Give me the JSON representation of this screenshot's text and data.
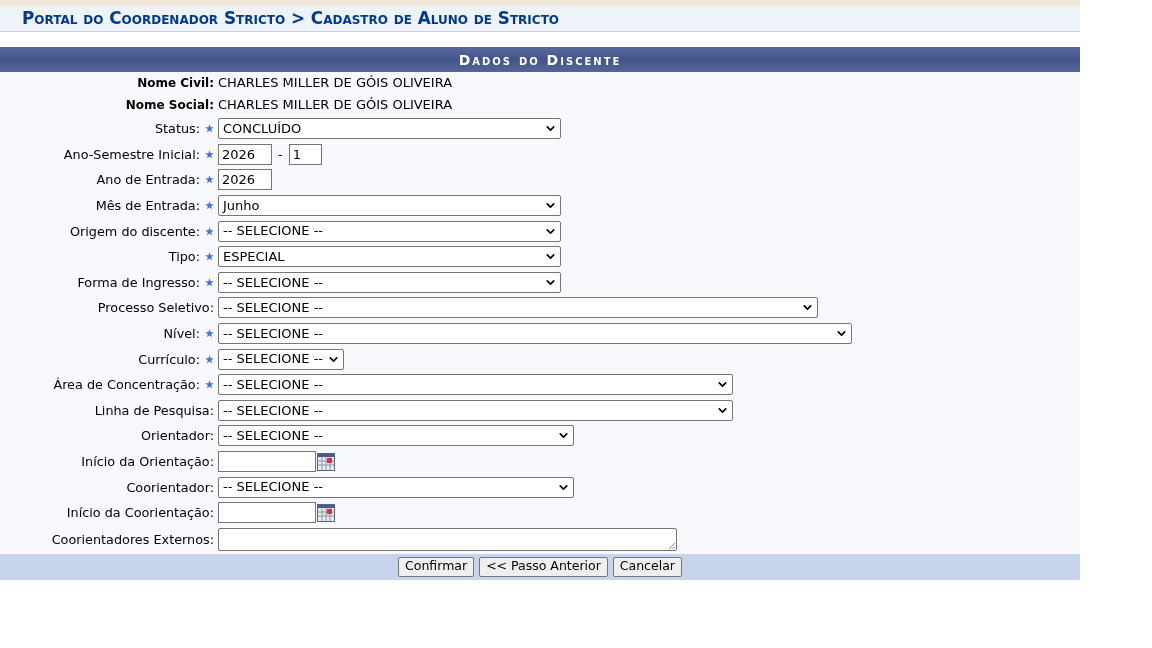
{
  "breadcrumb": "Portal do Coordenador Stricto > Cadastro de Aluno de Stricto",
  "form": {
    "title": "Dados do Discente",
    "fields": [
      {
        "label": "Nome Civil:",
        "required": false,
        "kind": "static",
        "value": "CHARLES MILLER DE GÓIS OLIVEIRA"
      },
      {
        "label": "Nome Social:",
        "required": false,
        "kind": "static",
        "value": "CHARLES MILLER DE GÓIS OLIVEIRA"
      },
      {
        "label": "Status:",
        "required": true,
        "kind": "select",
        "value": "CONCLUÍDO"
      },
      {
        "label": "Ano-Semestre Inicial:",
        "required": true,
        "kind": "year_semester",
        "year": "2026",
        "separator": "-",
        "semester": "1"
      },
      {
        "label": "Ano de Entrada:",
        "required": true,
        "kind": "text",
        "value": "2026"
      },
      {
        "label": "Mês de Entrada:",
        "required": true,
        "kind": "select",
        "value": "Junho"
      },
      {
        "label": "Origem do discente:",
        "required": true,
        "kind": "select",
        "value": "-- SELECIONE --"
      },
      {
        "label": "Tipo:",
        "required": true,
        "kind": "select",
        "value": "ESPECIAL"
      },
      {
        "label": "Forma de Ingresso:",
        "required": true,
        "kind": "select",
        "value": "-- SELECIONE --"
      },
      {
        "label": "Processo Seletivo:",
        "required": false,
        "kind": "select",
        "value": "-- SELECIONE --"
      },
      {
        "label": "Nível:",
        "required": true,
        "kind": "select",
        "value": "-- SELECIONE --"
      },
      {
        "label": "Currículo:",
        "required": true,
        "kind": "select",
        "value": "-- SELECIONE --"
      },
      {
        "label": "Área de Concentração:",
        "required": true,
        "kind": "select",
        "value": "-- SELECIONE --"
      },
      {
        "label": "Linha de Pesquisa:",
        "required": false,
        "kind": "select",
        "value": "-- SELECIONE --"
      },
      {
        "label": "Orientador:",
        "required": false,
        "kind": "select",
        "value": "-- SELECIONE --"
      },
      {
        "label": "Início da Orientação:",
        "required": false,
        "kind": "date"
      },
      {
        "label": "Coorientador:",
        "required": false,
        "kind": "select",
        "value": "-- SELECIONE --"
      },
      {
        "label": "Início da Coorientação:",
        "required": false,
        "kind": "date"
      },
      {
        "label": "Coorientadores Externos:",
        "required": false,
        "kind": "textarea"
      }
    ]
  },
  "buttons": [
    {
      "label": "Confirmar"
    },
    {
      "label": "<< Passo Anterior"
    },
    {
      "label": "Cancelar"
    }
  ]
}
